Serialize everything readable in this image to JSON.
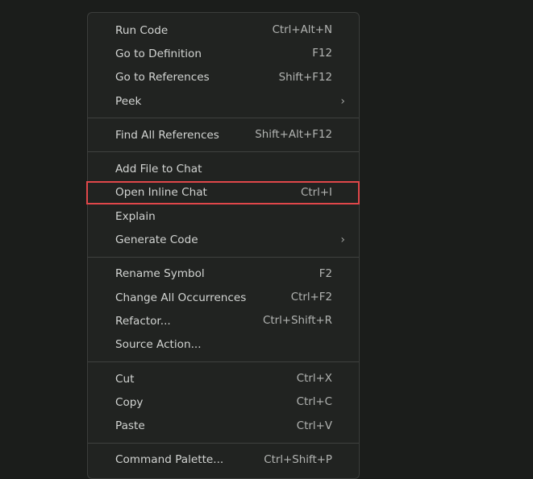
{
  "menu": {
    "groups": [
      [
        {
          "label": "Run Code",
          "shortcut": "Ctrl+Alt+N"
        },
        {
          "label": "Go to Definition",
          "shortcut": "F12"
        },
        {
          "label": "Go to References",
          "shortcut": "Shift+F12"
        },
        {
          "label": "Peek",
          "submenu": true,
          "chevron": "›"
        }
      ],
      [
        {
          "label": "Find All References",
          "shortcut": "Shift+Alt+F12"
        }
      ],
      [
        {
          "label": "Add File to Chat",
          "shortcut": ""
        },
        {
          "label": "Open Inline Chat",
          "shortcut": "Ctrl+I",
          "highlighted": true
        },
        {
          "label": "Explain",
          "shortcut": ""
        },
        {
          "label": "Generate Code",
          "submenu": true,
          "chevron": "›"
        }
      ],
      [
        {
          "label": "Rename Symbol",
          "shortcut": "F2"
        },
        {
          "label": "Change All Occurrences",
          "shortcut": "Ctrl+F2"
        },
        {
          "label": "Refactor...",
          "shortcut": "Ctrl+Shift+R"
        },
        {
          "label": "Source Action...",
          "shortcut": ""
        }
      ],
      [
        {
          "label": "Cut",
          "shortcut": "Ctrl+X"
        },
        {
          "label": "Copy",
          "shortcut": "Ctrl+C"
        },
        {
          "label": "Paste",
          "shortcut": "Ctrl+V"
        }
      ],
      [
        {
          "label": "Command Palette...",
          "shortcut": "Ctrl+Shift+P"
        }
      ]
    ],
    "highlight_color": "#e0474a"
  }
}
